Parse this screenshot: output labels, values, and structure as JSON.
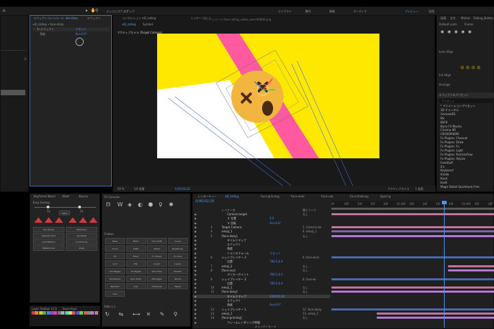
{
  "menubar": {
    "items": [
      "ファイル",
      "編集",
      "コンポジション",
      "レイヤー",
      "エフェクト",
      "アニメーション",
      "ビュー",
      "ウィンドウ",
      "ヘルプ",
      "",
      "",
      "",
      "",
      "",
      ""
    ],
    "right_items": [
      "ライブラリ",
      "整列",
      "情報",
      "オーディオ",
      "プレビュー",
      "段落"
    ]
  },
  "tools": {
    "labels": [
      "エッジにスナップ",
      "スナップ"
    ]
  },
  "left_panel": {
    "items": [
      "出1",
      "2",
      "3",
      "4"
    ]
  },
  "effects_panel": {
    "tab_label": "エフェクトコントロール: dia-dizzy",
    "tab2_label": "エフェクト",
    "comp_label": "eD_rolling • face-dizzy",
    "rows": [
      {
        "name": "fx エフェクト",
        "value": "リセット"
      },
      {
        "name": "角度",
        "value": "0x+0.0°"
      }
    ]
  },
  "viewer": {
    "tabs": [
      "コンポジション eD_rolling",
      "レイヤー (なし)",
      "フッテージ"
    ],
    "sub_tabs": [
      "eD_rolling",
      "Symbol"
    ],
    "path": "フッテージ face-rolling_video_over-00000.png",
    "camera_label": "アクティブカメラ (Target Camera)",
    "footer": {
      "zoom": "50 %",
      "quality": "1/2 画質",
      "time": "0;00;02;20",
      "view": "アクティブカメラ",
      "views": "1 画面"
    }
  },
  "right_panel": {
    "tabs": [
      "段落",
      "文字",
      "Motion",
      "Sliding_Button"
    ],
    "font_size_label": "Default units",
    "frame_label": "Frame",
    "sections": [
      "Lens Align",
      "Ink Align",
      "Arrange"
    ],
    "effects_title": "エフェクト&プリセット",
    "search_placeholder": "プリセット",
    "effects_list": [
      "* アニメーションプリセット",
      "3D チャンネル",
      "AnimatePS",
      "Blc",
      "BSF8",
      "Boris FX Mocha",
      "Cinema 4D",
      "CROSSPHERE",
      "Fx Plugins: Channel",
      "Fx Plugins: Draw",
      "Fx Plugins: Fx",
      "Fx Plugins: Light",
      "Fx Plugins: ParticleFlow",
      "Fx Plugins: Stylize",
      "FreeStuff",
      "iFx",
      "Keyboard",
      "Kindle",
      "Knoll",
      "Kraft",
      "Magic Bullet Quicktools Free"
    ]
  },
  "script_panel": {
    "tabs": [
      "Keyframe Wand",
      "Meld",
      "Boxcar"
    ],
    "easy_label": "Easy Easing",
    "values": [
      "70",
      "70"
    ],
    "apply_label": "apply",
    "buttons": [
      "QuickSnap",
      "Wallboard",
      "WakeUp Hold",
      "QuickNull",
      "QuickPattern",
      "QuickClone",
      "WallRemove",
      "Glass"
    ]
  },
  "toolbar_panel": {
    "title": "FX Console",
    "sub_title": "Flatten",
    "buttons": [
      "Base",
      "Black",
      "Chrs Shift",
      "Curve",
      "Curve",
      "LUMA",
      "White",
      "Brightness",
      "Fill",
      "Prism",
      "Fx Stroke",
      "Fx Glow",
      "Grid",
      "HSL",
      "Invert",
      "Levels",
      "Lite Wiggle",
      "Lit Wiggle",
      "Size Time",
      "Sleeker",
      "Silentanim",
      "Spin Hotel",
      "Stat Nigel",
      "Stroke",
      "Blanked",
      "Trail",
      "TimeCode",
      "Tweak",
      "Trim"
    ],
    "tool_title": "Rifle 1.1",
    "tool_icons": [
      "↻",
      "⇆",
      "⟷",
      "✕",
      "✎",
      "⚲"
    ]
  },
  "timeline": {
    "tabs": [
      "レンダーキュー",
      "eD_rolling",
      "Face-grinning",
      "Face-wink",
      "Face-sob",
      "Face-thinking",
      "Sparing"
    ],
    "timecode": "0;00;02;20",
    "columns": [
      "レイヤー名",
      "親とリンク"
    ],
    "rulers": [
      "0f",
      "05f",
      "10f",
      "15f",
      "20f",
      "01:00f",
      "05f",
      "10f",
      "15f",
      "20f",
      "02:00f",
      "05f",
      "10f"
    ],
    "layers": [
      {
        "n": "",
        "name": "Camera target",
        "val": "",
        "parent": "なし"
      },
      {
        "n": "",
        "name": "Ｚ 位置",
        "val": "0.0",
        "parent": ""
      },
      {
        "n": "",
        "name": "Ｘ 回転",
        "val": "0x+0.0°",
        "parent": ""
      },
      {
        "n": "3",
        "name": "Target Camera",
        "val": "",
        "parent": "1. Camera tar"
      },
      {
        "n": "4",
        "name": "emoji_1",
        "val": "",
        "parent": "4. emoji_1"
      },
      {
        "n": "5",
        "name": "[face-dizzy]",
        "val": "",
        "parent": "なし"
      },
      {
        "n": "",
        "name": "タイムリマップ",
        "val": "",
        "parent": ""
      },
      {
        "n": "",
        "name": "エフェクト",
        "val": "",
        "parent": ""
      },
      {
        "n": "",
        "name": "角度",
        "val": "",
        "parent": ""
      },
      {
        "n": "",
        "name": "トランスフォーム",
        "val": "リセット",
        "parent": ""
      },
      {
        "n": "6",
        "name": "シェイプレイヤー 3",
        "val": "",
        "parent": "6. face-wink"
      },
      {
        "n": "",
        "name": "位置",
        "val": "760.5,0.0",
        "parent": ""
      },
      {
        "n": "7",
        "name": "emoji_2",
        "val": "",
        "parent": "なし"
      },
      {
        "n": "8",
        "name": "[face-xxx]",
        "val": "",
        "parent": "なし"
      },
      {
        "n": "",
        "name": "アンカーポイント",
        "val": "760.5,0.0",
        "parent": ""
      },
      {
        "n": "9",
        "name": "シェイプレイヤー 3",
        "val": "",
        "parent": "8. face-wi"
      },
      {
        "n": "",
        "name": "位置",
        "val": "760.5,0.0",
        "parent": ""
      },
      {
        "n": "10",
        "name": "emoji_1",
        "val": "",
        "parent": "なし"
      },
      {
        "n": "11",
        "name": "[face-dizzy]",
        "val": "",
        "parent": "なし"
      },
      {
        "n": "",
        "name": "タイムリマップ",
        "val": "0;00;02;20",
        "parent": ""
      },
      {
        "n": "",
        "name": "エフェクト",
        "val": "",
        "parent": ""
      },
      {
        "n": "",
        "name": "角度",
        "val": "0x+0.0°",
        "parent": ""
      },
      {
        "n": "12",
        "name": "シェイプレイヤー 1",
        "val": "",
        "parent": "12. face-dizzy"
      },
      {
        "n": "13",
        "name": "emoji_1",
        "val": "",
        "parent": "13. emoji_1"
      },
      {
        "n": "14",
        "name": "[face-grinning]",
        "val": "",
        "parent": "なし"
      },
      {
        "n": "",
        "name": "フレームレンダリング時間",
        "val": "",
        "parent": ""
      }
    ],
    "bottom_label": "スイッチ / モード"
  },
  "bottom_left": {
    "title": "Layer Toolbar v1.0",
    "sub": "Save Hops"
  },
  "colors": {
    "yellow": "#ffe800",
    "pink": "#ff5aa0",
    "accent": "#4b94ff",
    "purple": "#b07bd8",
    "bar_pink": "#c8749a"
  }
}
